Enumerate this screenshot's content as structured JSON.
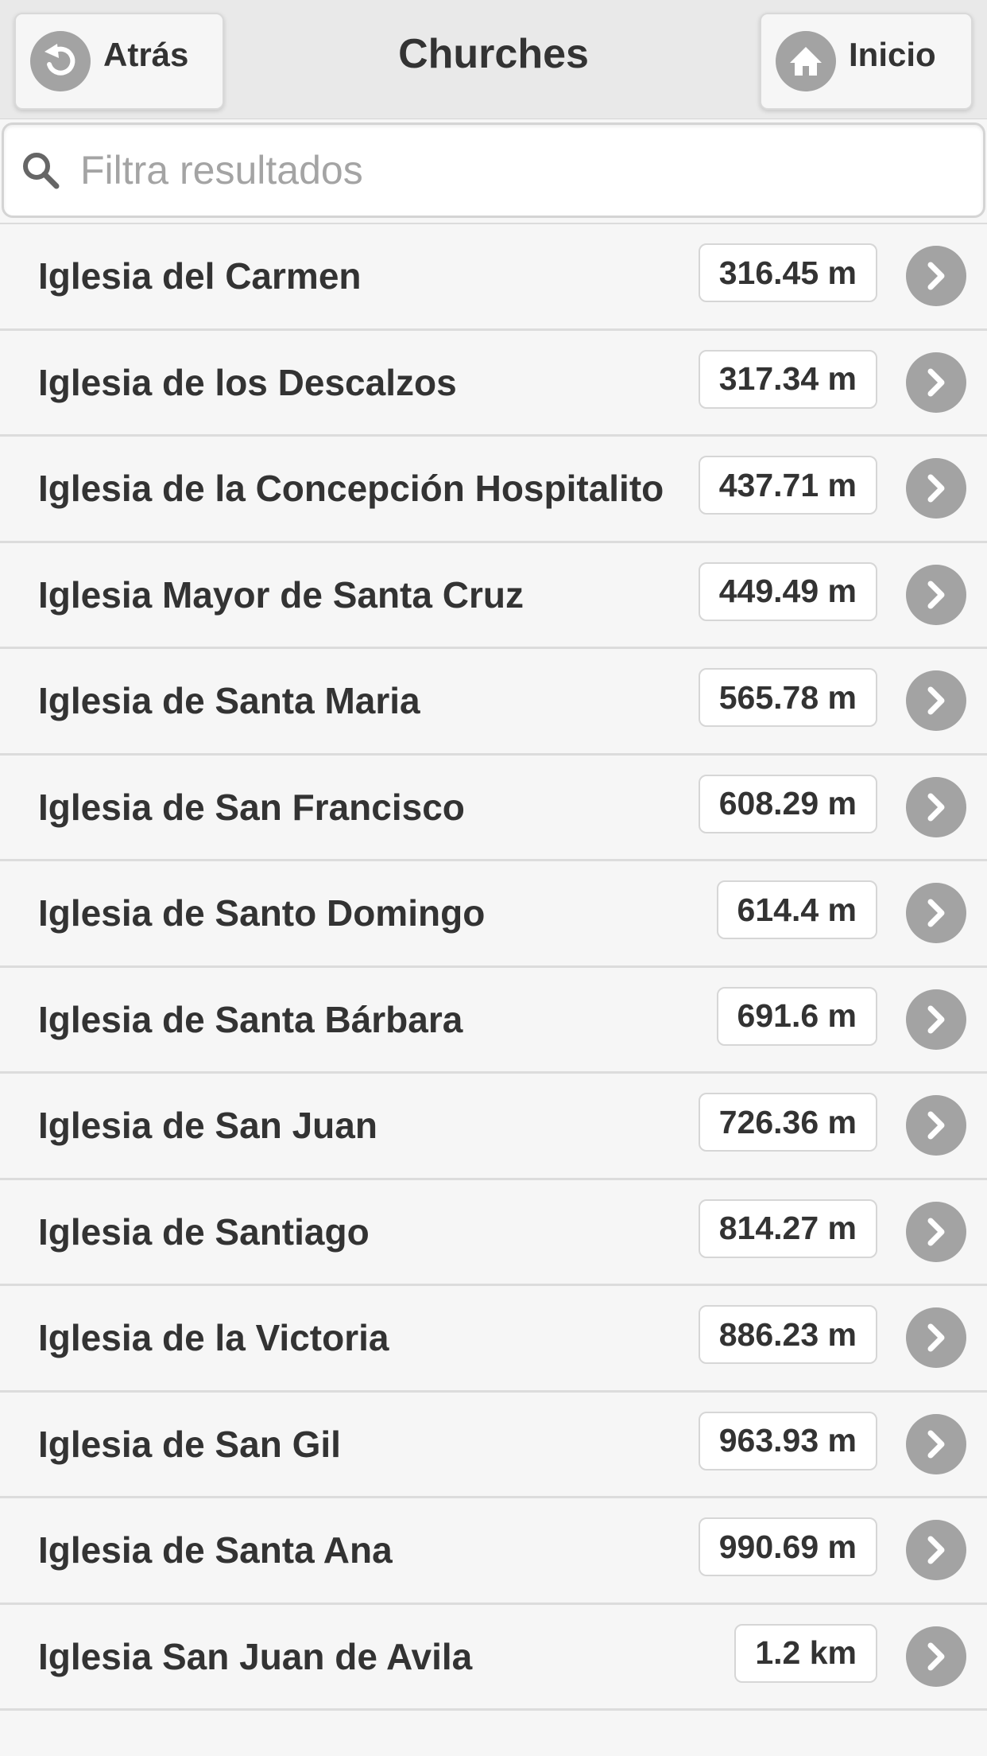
{
  "header": {
    "title": "Churches",
    "back_label": "Atrás",
    "home_label": "Inicio"
  },
  "search": {
    "placeholder": "Filtra resultados",
    "value": ""
  },
  "colors": {
    "header_bg": "#e9e9e9",
    "icon_circle": "#a3a3a3",
    "text": "#333333"
  },
  "items": [
    {
      "name": "Iglesia del Carmen",
      "distance": "316.45 m"
    },
    {
      "name": "Iglesia de los Descalzos",
      "distance": "317.34 m"
    },
    {
      "name": "Iglesia de la Concepción Hospitalito",
      "distance": "437.71 m"
    },
    {
      "name": "Iglesia Mayor de Santa Cruz",
      "distance": "449.49 m"
    },
    {
      "name": "Iglesia de Santa Maria",
      "distance": "565.78 m"
    },
    {
      "name": "Iglesia de San Francisco",
      "distance": "608.29 m"
    },
    {
      "name": "Iglesia de Santo Domingo",
      "distance": "614.4 m"
    },
    {
      "name": "Iglesia de Santa Bárbara",
      "distance": "691.6 m"
    },
    {
      "name": "Iglesia de San Juan",
      "distance": "726.36 m"
    },
    {
      "name": "Iglesia de Santiago",
      "distance": "814.27 m"
    },
    {
      "name": "Iglesia de la Victoria",
      "distance": "886.23 m"
    },
    {
      "name": "Iglesia de San Gil",
      "distance": "963.93 m"
    },
    {
      "name": "Iglesia de Santa Ana",
      "distance": "990.69 m"
    },
    {
      "name": "Iglesia San Juan de Avila",
      "distance": "1.2 km"
    }
  ]
}
